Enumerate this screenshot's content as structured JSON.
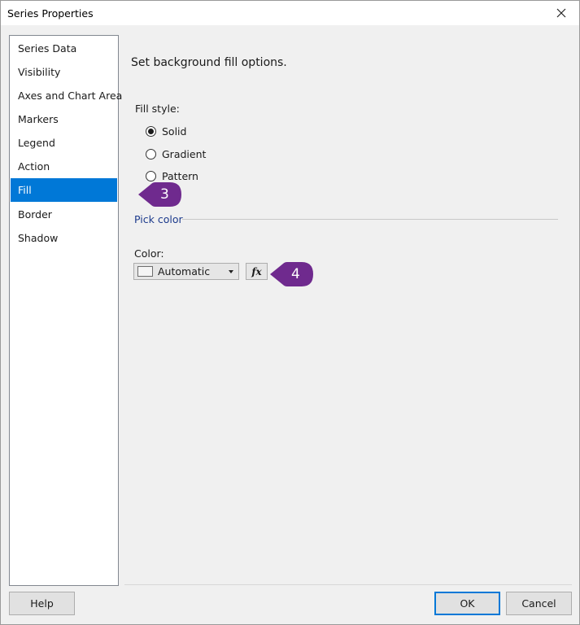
{
  "window": {
    "title": "Series Properties"
  },
  "sidebar": {
    "items": [
      {
        "label": "Series Data",
        "selected": false
      },
      {
        "label": "Visibility",
        "selected": false
      },
      {
        "label": "Axes and Chart Area",
        "selected": false
      },
      {
        "label": "Markers",
        "selected": false
      },
      {
        "label": "Legend",
        "selected": false
      },
      {
        "label": "Action",
        "selected": false
      },
      {
        "label": "Fill",
        "selected": true
      },
      {
        "label": "Border",
        "selected": false
      },
      {
        "label": "Shadow",
        "selected": false
      }
    ]
  },
  "main": {
    "heading": "Set background fill options.",
    "fill_style": {
      "label": "Fill style:",
      "options": [
        {
          "label": "Solid",
          "checked": true
        },
        {
          "label": "Gradient",
          "checked": false
        },
        {
          "label": "Pattern",
          "checked": false
        }
      ]
    },
    "pick_color": {
      "group_title": "Pick color",
      "color_label": "Color:",
      "color_value": "Automatic",
      "fx_label": "fx"
    }
  },
  "callouts": [
    {
      "number": "3",
      "color": "#6f2a8e"
    },
    {
      "number": "4",
      "color": "#6f2a8e"
    }
  ],
  "footer": {
    "help": "Help",
    "ok": "OK",
    "cancel": "Cancel"
  },
  "colors": {
    "selection": "#0078d7",
    "group_title": "#1c3a8c",
    "callout": "#6f2a8e"
  }
}
